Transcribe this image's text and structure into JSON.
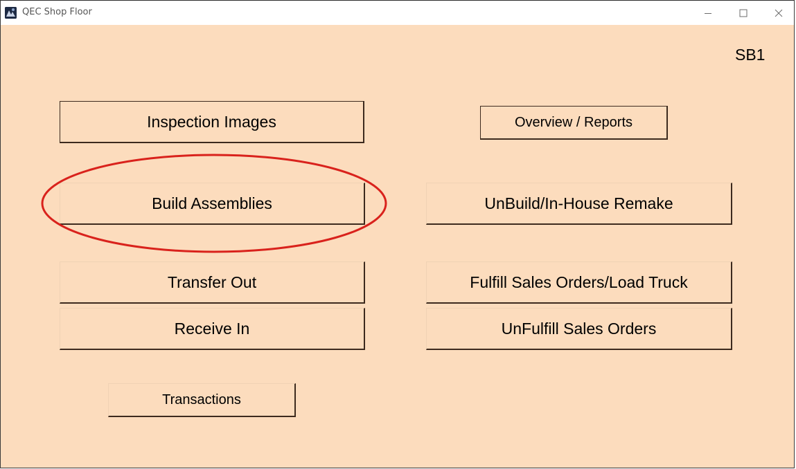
{
  "window": {
    "title": "QEC Shop Floor",
    "controls": {
      "minimize": "─",
      "maximize": "☐",
      "close": "✕"
    }
  },
  "station_label": "SB1",
  "buttons": {
    "inspection_images": "Inspection Images",
    "overview_reports": "Overview / Reports",
    "build_assemblies": "Build Assemblies",
    "unbuild_remake": "UnBuild/In-House Remake",
    "transfer_out": "Transfer Out",
    "fulfill_sales_orders": "Fulfill Sales Orders/Load Truck",
    "receive_in": "Receive In",
    "unfulfill_sales_orders": "UnFulfill Sales Orders",
    "transactions": "Transactions"
  },
  "annotation": {
    "highlight_color": "#d9221c"
  }
}
